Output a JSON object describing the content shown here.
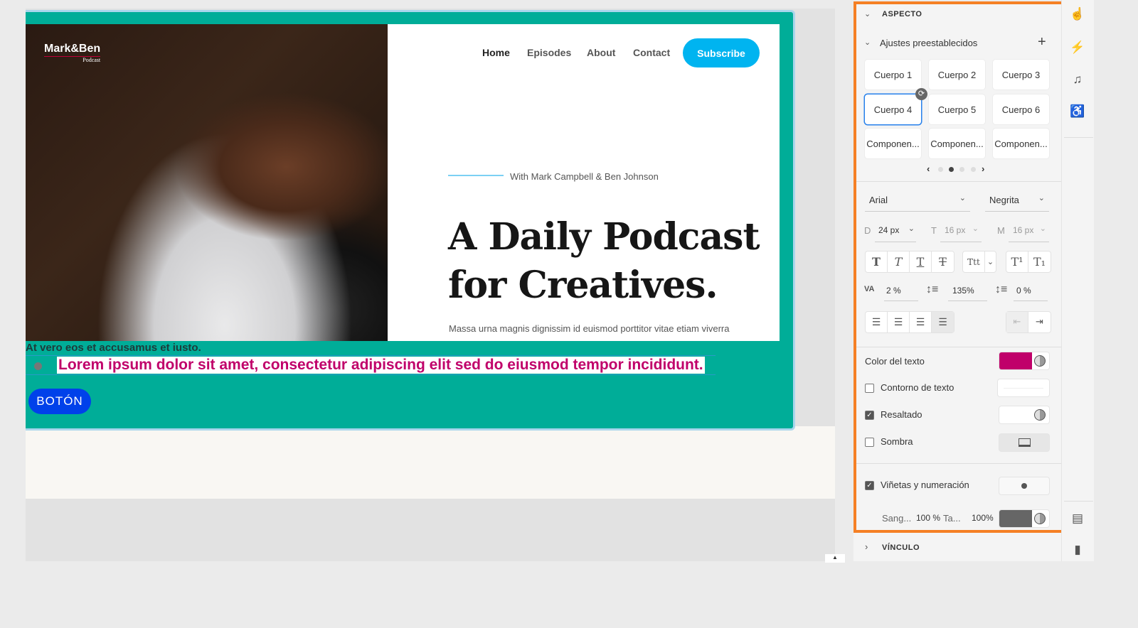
{
  "site": {
    "logo": {
      "name": "Mark&Ben",
      "sub": "Podcast"
    },
    "nav": [
      "Home",
      "Episodes",
      "About",
      "Contact"
    ],
    "subscribe": "Subscribe",
    "tagline": "With Mark Campbell & Ben Johnson",
    "headline_1": "A Daily Podcast",
    "headline_2": "for Creatives.",
    "body": "Massa urna magnis dignissim id euismod porttitor vitae etiam viverra",
    "at_vero": "At vero eos et accusamus et iusto.",
    "lorem": "Lorem ipsum dolor sit amet, consectetur adipiscing elit sed do eiusmod tempor incididunt.",
    "button": "BOTÓN"
  },
  "panel": {
    "section": "ASPECTO",
    "presets_label": "Ajustes preestablecidos",
    "presets": [
      "Cuerpo 1",
      "Cuerpo 2",
      "Cuerpo 3",
      "Cuerpo 4",
      "Cuerpo 5",
      "Cuerpo 6",
      "Componen...",
      "Componen...",
      "Componen..."
    ],
    "selected_preset": "Cuerpo 4",
    "page_dots": {
      "count": 4,
      "active": 2
    },
    "font": "Arial",
    "weight": "Negrita",
    "size_d_label": "D",
    "size_d": "24 px",
    "size_t_label": "T",
    "size_t": "16 px",
    "size_m_label": "M",
    "size_m": "16 px",
    "tracking": "2 %",
    "line_height": "135%",
    "para_spacing": "0 %",
    "text_color_label": "Color del texto",
    "text_color": "#c0006a",
    "outline_label": "Contorno de texto",
    "highlight_label": "Resaltado",
    "shadow_label": "Sombra",
    "bullets_label": "Viñetas y numeración",
    "indent_label": "Sang...",
    "indent": "100 %",
    "size_label": "Ta...",
    "size_val": "100%",
    "link_section": "VÍNCULO"
  },
  "colors": {
    "accent": "#f58025",
    "teal": "#00ad98",
    "subscribe": "#00b4f0",
    "button": "#0041ea"
  }
}
